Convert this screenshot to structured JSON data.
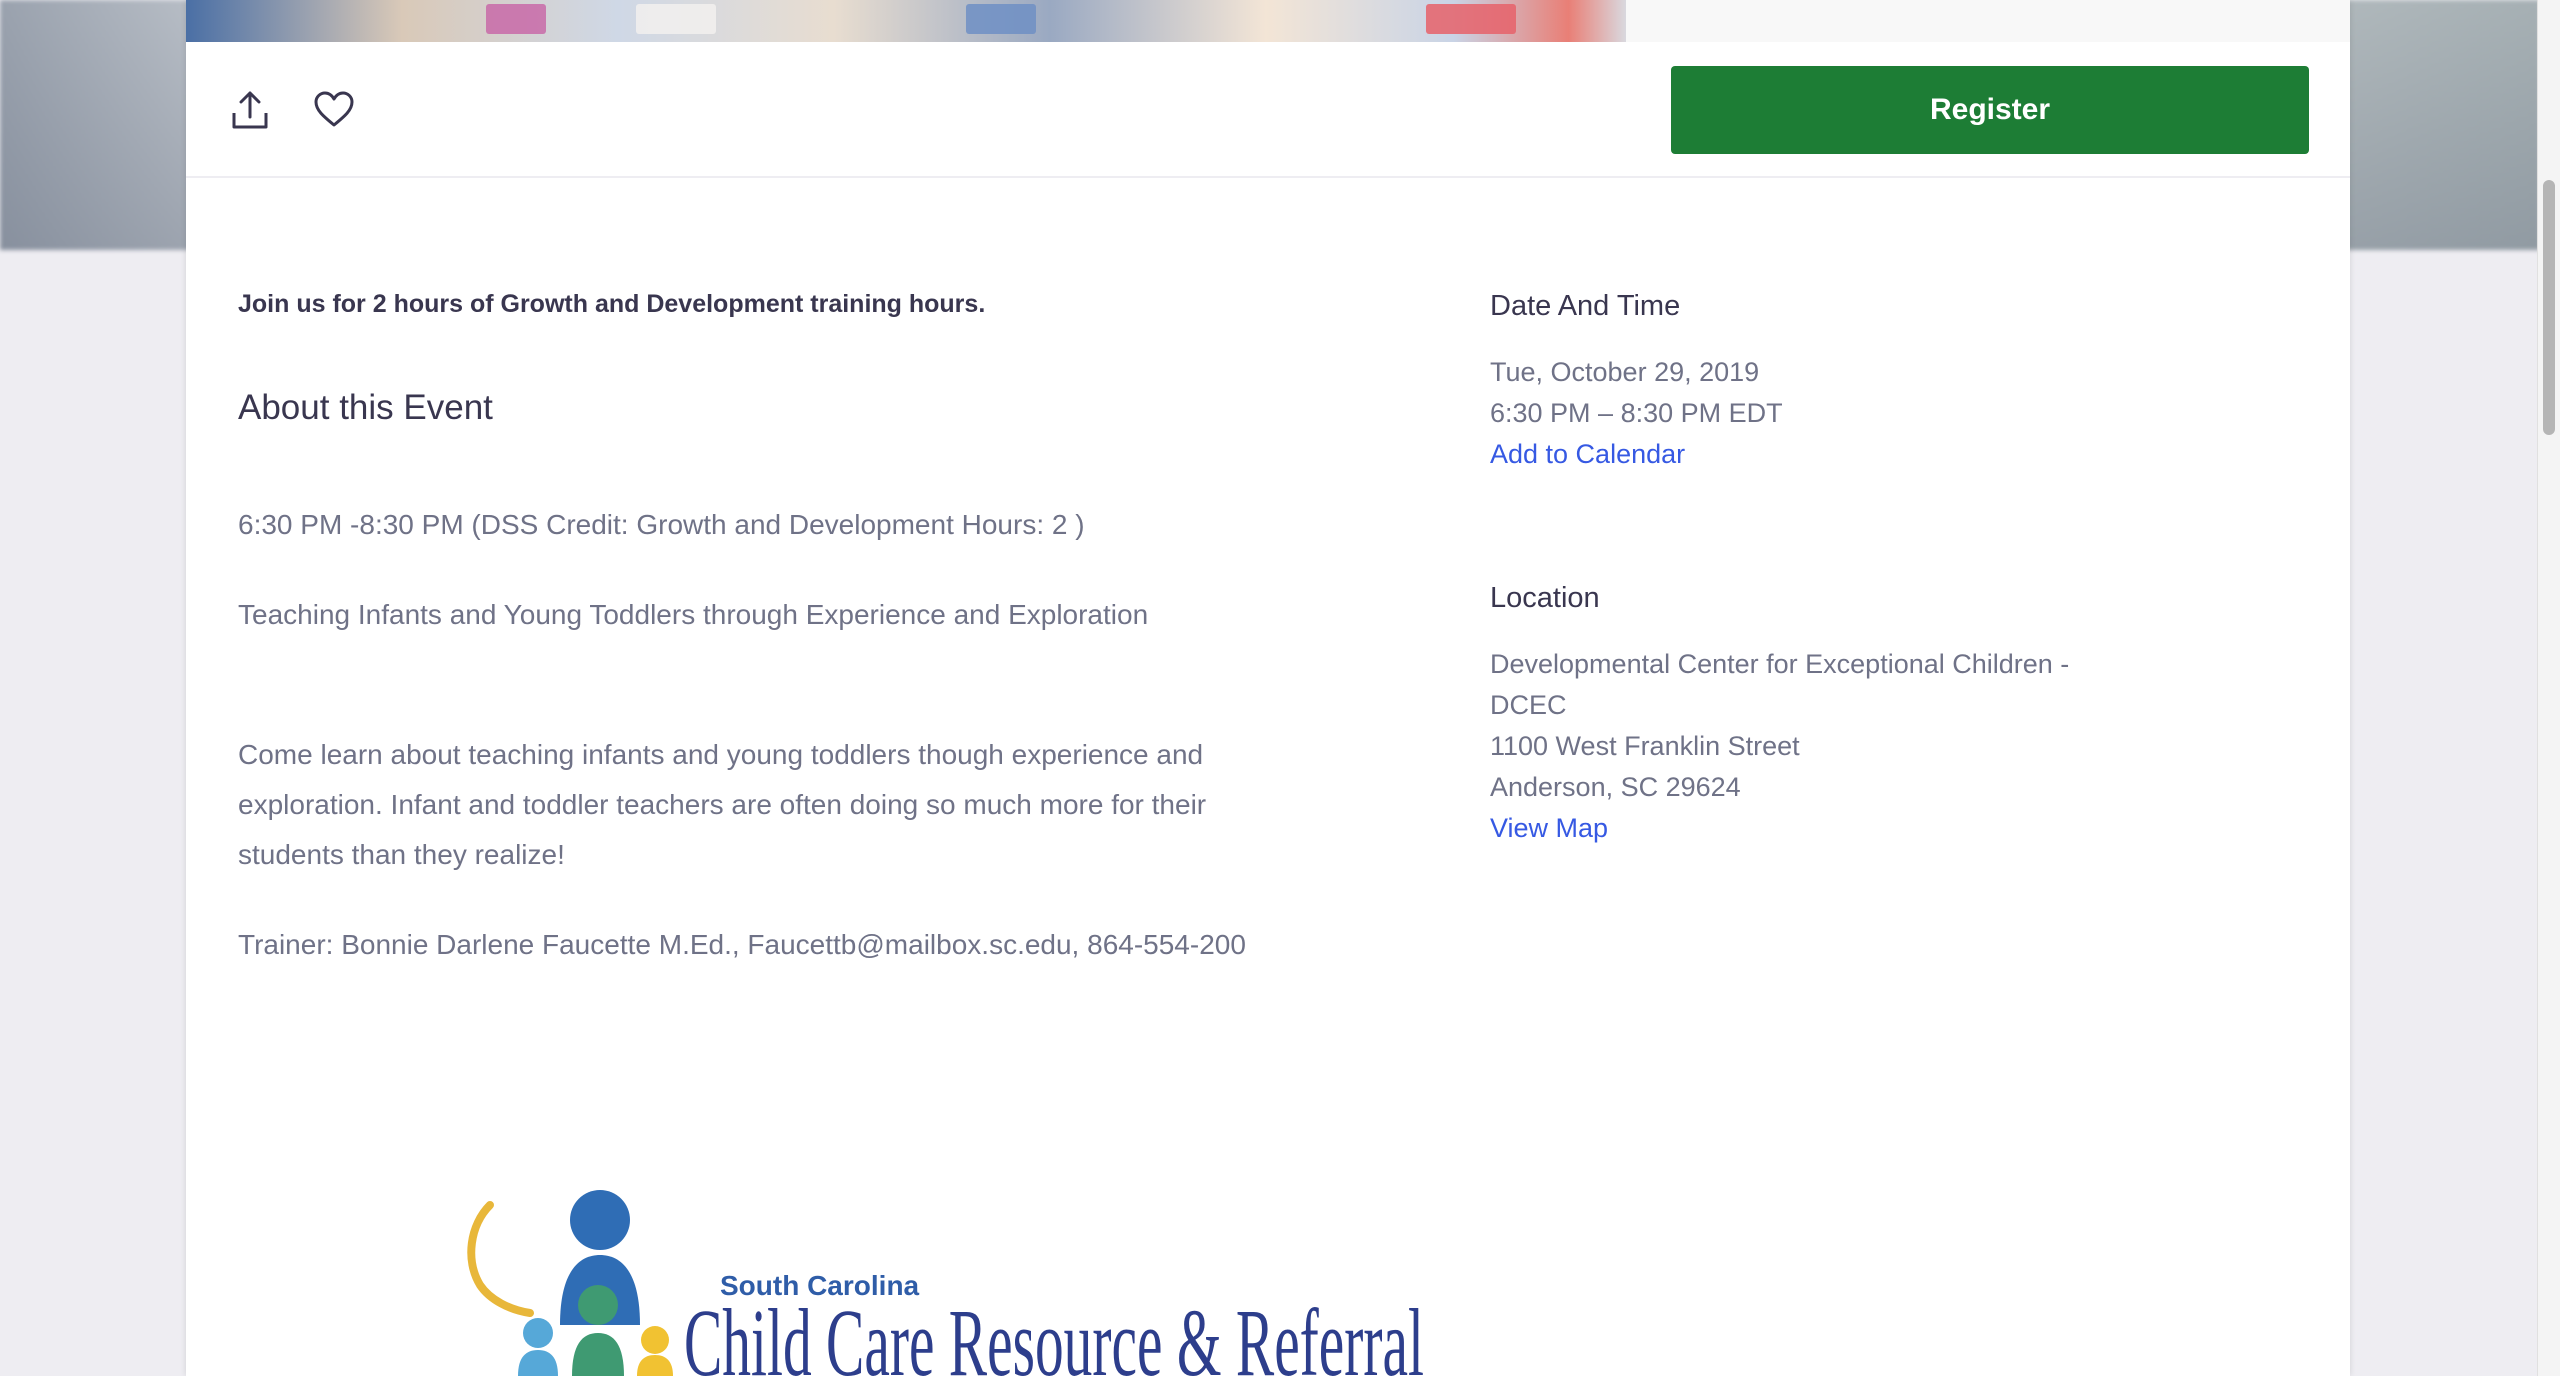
{
  "register": {
    "label": "Register"
  },
  "icons": {
    "share": "share-icon",
    "like": "heart-icon"
  },
  "event": {
    "summary": "Join us for 2 hours of Growth and Development training hours.",
    "about_title": "About this Event",
    "paragraphs": [
      "6:30 PM -8:30 PM (DSS Credit: Growth and Development Hours: 2 )",
      "Teaching Infants and Young Toddlers through Experience and Exploration",
      "Come learn about teaching infants and young toddlers though experience and exploration. Infant and toddler teachers are often doing so much more for their students than they realize!",
      "Trainer: Bonnie Darlene Faucette M.Ed., Faucettb@mailbox.sc.edu, 864-554-200"
    ]
  },
  "date_time": {
    "heading": "Date And Time",
    "date": "Tue, October 29, 2019",
    "time": "6:30 PM – 8:30 PM EDT",
    "calendar_link": "Add to Calendar"
  },
  "location": {
    "heading": "Location",
    "lines": [
      "Developmental Center for Exceptional Children - DCEC",
      "1100 West Franklin Street",
      "Anderson, SC 29624"
    ],
    "map_link": "View Map"
  },
  "logo": {
    "state": "South Carolina",
    "name": "Child Care Resource & Referral"
  },
  "colors": {
    "register_green": "#1d7d35",
    "link_blue": "#3659e3",
    "heading": "#39364f",
    "body": "#6f7287"
  }
}
